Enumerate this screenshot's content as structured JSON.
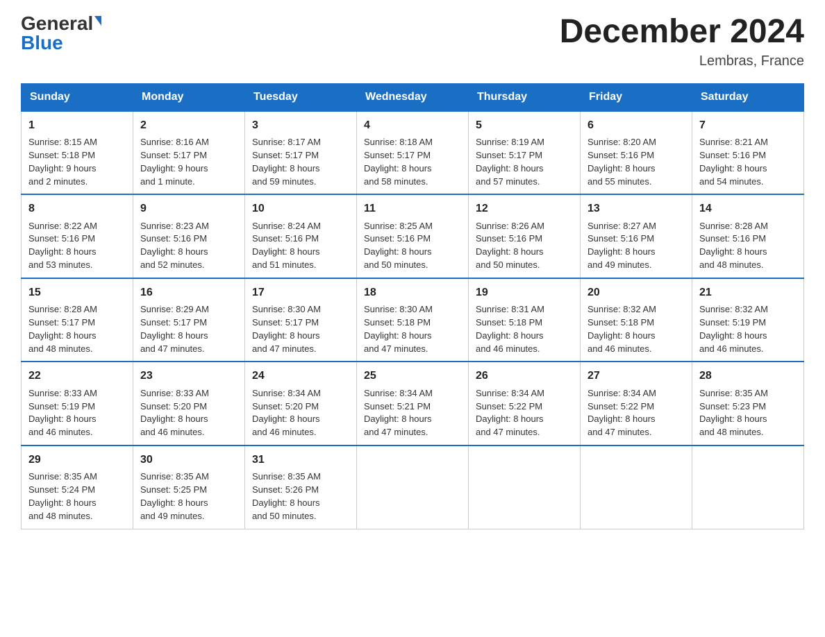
{
  "header": {
    "logo_general": "General",
    "logo_blue": "Blue",
    "month_title": "December 2024",
    "location": "Lembras, France"
  },
  "weekdays": [
    "Sunday",
    "Monday",
    "Tuesday",
    "Wednesday",
    "Thursday",
    "Friday",
    "Saturday"
  ],
  "weeks": [
    [
      {
        "day": "1",
        "sunrise": "8:15 AM",
        "sunset": "5:18 PM",
        "daylight": "9 hours and 2 minutes."
      },
      {
        "day": "2",
        "sunrise": "8:16 AM",
        "sunset": "5:17 PM",
        "daylight": "9 hours and 1 minute."
      },
      {
        "day": "3",
        "sunrise": "8:17 AM",
        "sunset": "5:17 PM",
        "daylight": "8 hours and 59 minutes."
      },
      {
        "day": "4",
        "sunrise": "8:18 AM",
        "sunset": "5:17 PM",
        "daylight": "8 hours and 58 minutes."
      },
      {
        "day": "5",
        "sunrise": "8:19 AM",
        "sunset": "5:17 PM",
        "daylight": "8 hours and 57 minutes."
      },
      {
        "day": "6",
        "sunrise": "8:20 AM",
        "sunset": "5:16 PM",
        "daylight": "8 hours and 55 minutes."
      },
      {
        "day": "7",
        "sunrise": "8:21 AM",
        "sunset": "5:16 PM",
        "daylight": "8 hours and 54 minutes."
      }
    ],
    [
      {
        "day": "8",
        "sunrise": "8:22 AM",
        "sunset": "5:16 PM",
        "daylight": "8 hours and 53 minutes."
      },
      {
        "day": "9",
        "sunrise": "8:23 AM",
        "sunset": "5:16 PM",
        "daylight": "8 hours and 52 minutes."
      },
      {
        "day": "10",
        "sunrise": "8:24 AM",
        "sunset": "5:16 PM",
        "daylight": "8 hours and 51 minutes."
      },
      {
        "day": "11",
        "sunrise": "8:25 AM",
        "sunset": "5:16 PM",
        "daylight": "8 hours and 50 minutes."
      },
      {
        "day": "12",
        "sunrise": "8:26 AM",
        "sunset": "5:16 PM",
        "daylight": "8 hours and 50 minutes."
      },
      {
        "day": "13",
        "sunrise": "8:27 AM",
        "sunset": "5:16 PM",
        "daylight": "8 hours and 49 minutes."
      },
      {
        "day": "14",
        "sunrise": "8:28 AM",
        "sunset": "5:16 PM",
        "daylight": "8 hours and 48 minutes."
      }
    ],
    [
      {
        "day": "15",
        "sunrise": "8:28 AM",
        "sunset": "5:17 PM",
        "daylight": "8 hours and 48 minutes."
      },
      {
        "day": "16",
        "sunrise": "8:29 AM",
        "sunset": "5:17 PM",
        "daylight": "8 hours and 47 minutes."
      },
      {
        "day": "17",
        "sunrise": "8:30 AM",
        "sunset": "5:17 PM",
        "daylight": "8 hours and 47 minutes."
      },
      {
        "day": "18",
        "sunrise": "8:30 AM",
        "sunset": "5:18 PM",
        "daylight": "8 hours and 47 minutes."
      },
      {
        "day": "19",
        "sunrise": "8:31 AM",
        "sunset": "5:18 PM",
        "daylight": "8 hours and 46 minutes."
      },
      {
        "day": "20",
        "sunrise": "8:32 AM",
        "sunset": "5:18 PM",
        "daylight": "8 hours and 46 minutes."
      },
      {
        "day": "21",
        "sunrise": "8:32 AM",
        "sunset": "5:19 PM",
        "daylight": "8 hours and 46 minutes."
      }
    ],
    [
      {
        "day": "22",
        "sunrise": "8:33 AM",
        "sunset": "5:19 PM",
        "daylight": "8 hours and 46 minutes."
      },
      {
        "day": "23",
        "sunrise": "8:33 AM",
        "sunset": "5:20 PM",
        "daylight": "8 hours and 46 minutes."
      },
      {
        "day": "24",
        "sunrise": "8:34 AM",
        "sunset": "5:20 PM",
        "daylight": "8 hours and 46 minutes."
      },
      {
        "day": "25",
        "sunrise": "8:34 AM",
        "sunset": "5:21 PM",
        "daylight": "8 hours and 47 minutes."
      },
      {
        "day": "26",
        "sunrise": "8:34 AM",
        "sunset": "5:22 PM",
        "daylight": "8 hours and 47 minutes."
      },
      {
        "day": "27",
        "sunrise": "8:34 AM",
        "sunset": "5:22 PM",
        "daylight": "8 hours and 47 minutes."
      },
      {
        "day": "28",
        "sunrise": "8:35 AM",
        "sunset": "5:23 PM",
        "daylight": "8 hours and 48 minutes."
      }
    ],
    [
      {
        "day": "29",
        "sunrise": "8:35 AM",
        "sunset": "5:24 PM",
        "daylight": "8 hours and 48 minutes."
      },
      {
        "day": "30",
        "sunrise": "8:35 AM",
        "sunset": "5:25 PM",
        "daylight": "8 hours and 49 minutes."
      },
      {
        "day": "31",
        "sunrise": "8:35 AM",
        "sunset": "5:26 PM",
        "daylight": "8 hours and 50 minutes."
      },
      null,
      null,
      null,
      null
    ]
  ],
  "labels": {
    "sunrise": "Sunrise:",
    "sunset": "Sunset:",
    "daylight": "Daylight:"
  }
}
